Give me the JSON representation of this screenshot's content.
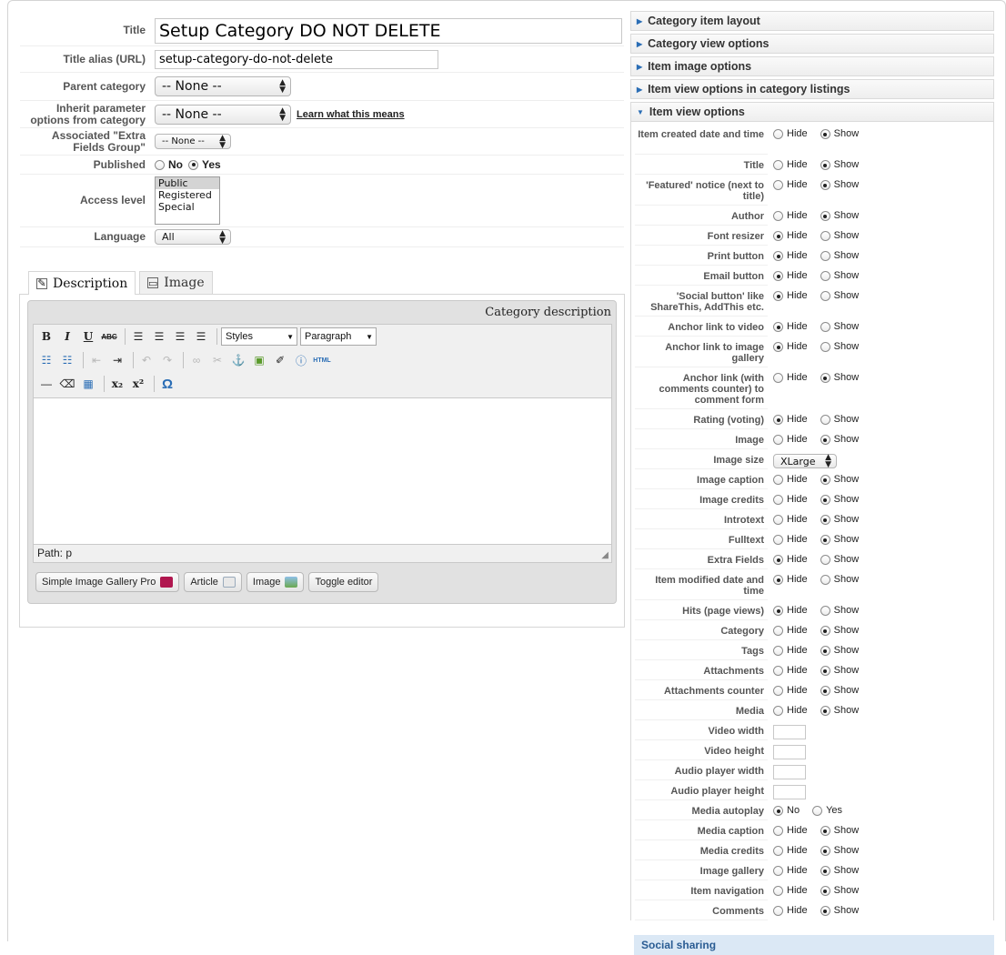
{
  "form": {
    "title_label": "Title",
    "title_value": "Setup Category DO NOT DELETE",
    "alias_label": "Title alias (URL)",
    "alias_value": "setup-category-do-not-delete",
    "parent_label": "Parent category",
    "parent_value": "-- None --",
    "inherit_label": "Inherit parameter options from category",
    "inherit_value": "-- None --",
    "inherit_link": "Learn what this means",
    "extra_label": "Associated \"Extra Fields Group\"",
    "extra_value": "-- None --",
    "published_label": "Published",
    "published_no": "No",
    "published_yes": "Yes",
    "access_label": "Access level",
    "access_options": [
      "Public",
      "Registered",
      "Special"
    ],
    "language_label": "Language",
    "language_value": "All"
  },
  "tabs": {
    "description": "Description",
    "image": "Image"
  },
  "editor": {
    "title": "Category description",
    "styles": "Styles",
    "format": "Paragraph",
    "path": "Path: p",
    "buttons": [
      "Simple Image Gallery Pro",
      "Article",
      "Image",
      "Toggle editor"
    ],
    "html_btn": "HTML"
  },
  "accordion": {
    "items": [
      "Category item layout",
      "Category view options",
      "Item image options",
      "Item view options in category listings",
      "Item view options"
    ],
    "social": "Social sharing"
  },
  "hide": "Hide",
  "show": "Show",
  "no": "No",
  "yes": "Yes",
  "image_size_value": "XLarge",
  "item_view_options": [
    {
      "label": "Item created date and time",
      "type": "hs",
      "value": "show"
    },
    {
      "label": "Title",
      "type": "hs",
      "value": "show"
    },
    {
      "label": "'Featured' notice (next to title)",
      "type": "hs",
      "value": "show"
    },
    {
      "label": "Author",
      "type": "hs",
      "value": "show"
    },
    {
      "label": "Font resizer",
      "type": "hs",
      "value": "hide"
    },
    {
      "label": "Print button",
      "type": "hs",
      "value": "hide"
    },
    {
      "label": "Email button",
      "type": "hs",
      "value": "hide"
    },
    {
      "label": "'Social button' like ShareThis, AddThis etc.",
      "type": "hs",
      "value": "hide"
    },
    {
      "label": "Anchor link to video",
      "type": "hs",
      "value": "hide"
    },
    {
      "label": "Anchor link to image gallery",
      "type": "hs",
      "value": "hide"
    },
    {
      "label": "Anchor link (with comments counter) to comment form",
      "type": "hs",
      "value": "show"
    },
    {
      "label": "Rating (voting)",
      "type": "hs",
      "value": "hide"
    },
    {
      "label": "Image",
      "type": "hs",
      "value": "show"
    },
    {
      "label": "Image size",
      "type": "select"
    },
    {
      "label": "Image caption",
      "type": "hs",
      "value": "show"
    },
    {
      "label": "Image credits",
      "type": "hs",
      "value": "show"
    },
    {
      "label": "Introtext",
      "type": "hs",
      "value": "show"
    },
    {
      "label": "Fulltext",
      "type": "hs",
      "value": "show"
    },
    {
      "label": "Extra Fields",
      "type": "hs",
      "value": "hide"
    },
    {
      "label": "Item modified date and time",
      "type": "hs",
      "value": "hide"
    },
    {
      "label": "Hits (page views)",
      "type": "hs",
      "value": "hide"
    },
    {
      "label": "Category",
      "type": "hs",
      "value": "show"
    },
    {
      "label": "Tags",
      "type": "hs",
      "value": "show"
    },
    {
      "label": "Attachments",
      "type": "hs",
      "value": "show"
    },
    {
      "label": "Attachments counter",
      "type": "hs",
      "value": "show"
    },
    {
      "label": "Media",
      "type": "hs",
      "value": "show"
    },
    {
      "label": "Video width",
      "type": "text"
    },
    {
      "label": "Video height",
      "type": "text"
    },
    {
      "label": "Audio player width",
      "type": "text"
    },
    {
      "label": "Audio player height",
      "type": "text"
    },
    {
      "label": "Media autoplay",
      "type": "ny",
      "value": "no"
    },
    {
      "label": "Media caption",
      "type": "hs",
      "value": "show"
    },
    {
      "label": "Media credits",
      "type": "hs",
      "value": "show"
    },
    {
      "label": "Image gallery",
      "type": "hs",
      "value": "show"
    },
    {
      "label": "Item navigation",
      "type": "hs",
      "value": "show"
    },
    {
      "label": "Comments",
      "type": "hs",
      "value": "show"
    }
  ]
}
